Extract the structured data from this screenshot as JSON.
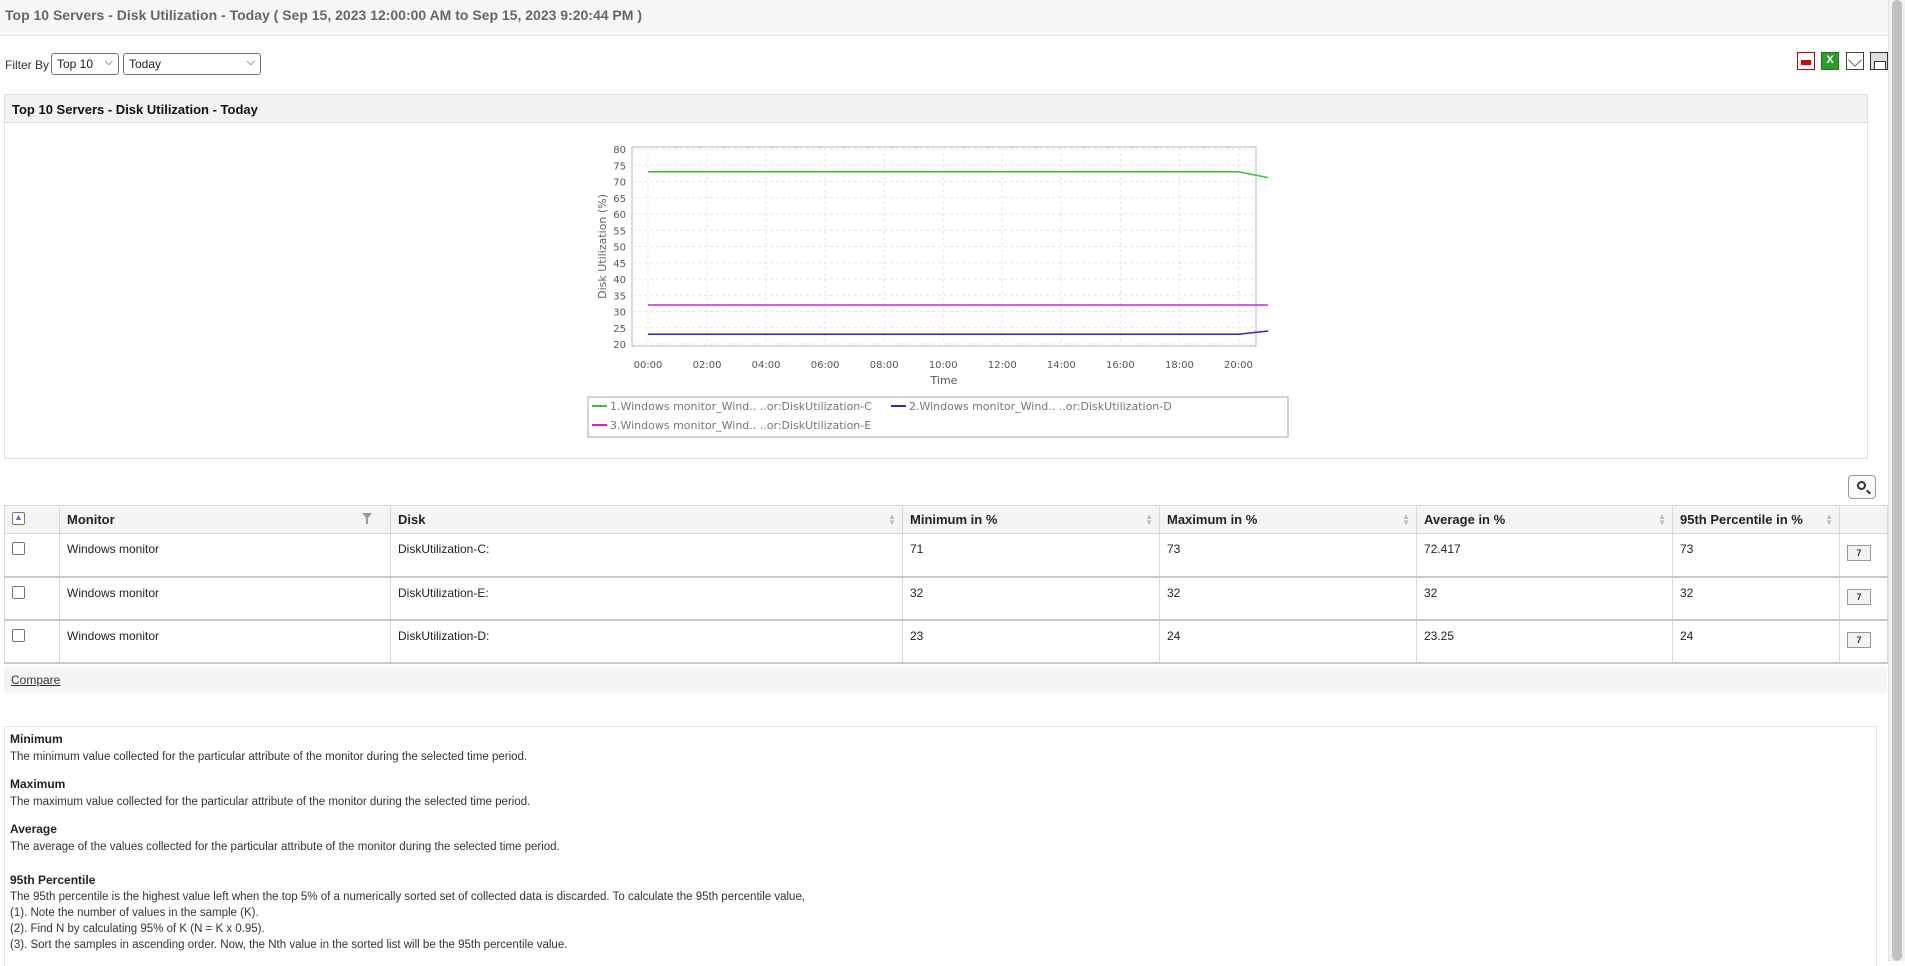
{
  "page_title": "Top 10 Servers - Disk Utilization - Today ( Sep 15, 2023 12:00:00 AM to Sep 15, 2023 9:20:44 PM )",
  "filter": {
    "label": "Filter By",
    "top_select": "Top 10",
    "period_select": "Today"
  },
  "export_icons": [
    "pdf-icon",
    "excel-icon",
    "email-icon",
    "print-icon"
  ],
  "chart_panel": {
    "title": "Top 10 Servers - Disk Utilization - Today"
  },
  "chart_data": {
    "type": "line",
    "xlabel": "Time",
    "ylabel": "Disk Utilization (%)",
    "ylim": [
      20,
      80
    ],
    "yticks": [
      "80",
      "75",
      "70",
      "65",
      "60",
      "55",
      "50",
      "45",
      "40",
      "35",
      "30",
      "25",
      "20"
    ],
    "xticks": [
      "00:00",
      "02:00",
      "04:00",
      "06:00",
      "08:00",
      "10:00",
      "12:00",
      "14:00",
      "16:00",
      "18:00",
      "20:00"
    ],
    "x_hours": [
      0,
      20,
      21
    ],
    "grid": true,
    "legend_position": "bottom",
    "series": [
      {
        "name": "1.Windows monitor_Wind.. ..or:DiskUtilization-C",
        "color": "#33c233",
        "values": [
          73,
          73,
          71.2
        ]
      },
      {
        "name": "2.Windows monitor_Wind.. ..or:DiskUtilization-D",
        "color": "#2a2ab8",
        "values": [
          23,
          23,
          24
        ]
      },
      {
        "name": "3.Windows monitor_Wind.. ..or:DiskUtilization-E",
        "color": "#c030c0",
        "values": [
          32,
          32,
          32
        ]
      }
    ]
  },
  "table": {
    "headers": {
      "monitor": "Monitor",
      "disk": "Disk",
      "min": "Minimum in %",
      "max": "Maximum in %",
      "avg": "Average in %",
      "p95": "95th Percentile in %"
    },
    "rows": [
      {
        "monitor": "Windows monitor",
        "disk": "DiskUtilization-C:",
        "min": "71",
        "max": "73",
        "avg": "72.417",
        "p95": "73"
      },
      {
        "monitor": "Windows monitor",
        "disk": "DiskUtilization-E:",
        "min": "32",
        "max": "32",
        "avg": "32",
        "p95": "32"
      },
      {
        "monitor": "Windows monitor",
        "disk": "DiskUtilization-D:",
        "min": "23",
        "max": "24",
        "avg": "23.25",
        "p95": "24"
      }
    ],
    "action_glyph": "7"
  },
  "compare_link": "Compare",
  "definitions": {
    "minimum_term": "Minimum",
    "minimum_desc": "The minimum value collected for the particular attribute of the monitor during the selected time period.",
    "maximum_term": "Maximum",
    "maximum_desc": "The maximum value collected for the particular attribute of the monitor during the selected time period.",
    "average_term": "Average",
    "average_desc": "The average of the values collected for the particular attribute of the monitor during the selected time period.",
    "p95_term": "95th Percentile",
    "p95_desc": "The 95th percentile is the highest value left when the top 5% of a numerically sorted set of collected data is discarded. To calculate the 95th percentile value,",
    "p95_step1": "(1). Note the number of values in the sample (K).",
    "p95_step2": "(2). Find N by calculating 95% of K (N = K x 0.95).",
    "p95_step3": "(3). Sort the samples in ascending order. Now, the Nth value in the sorted list will be the 95th percentile value."
  }
}
